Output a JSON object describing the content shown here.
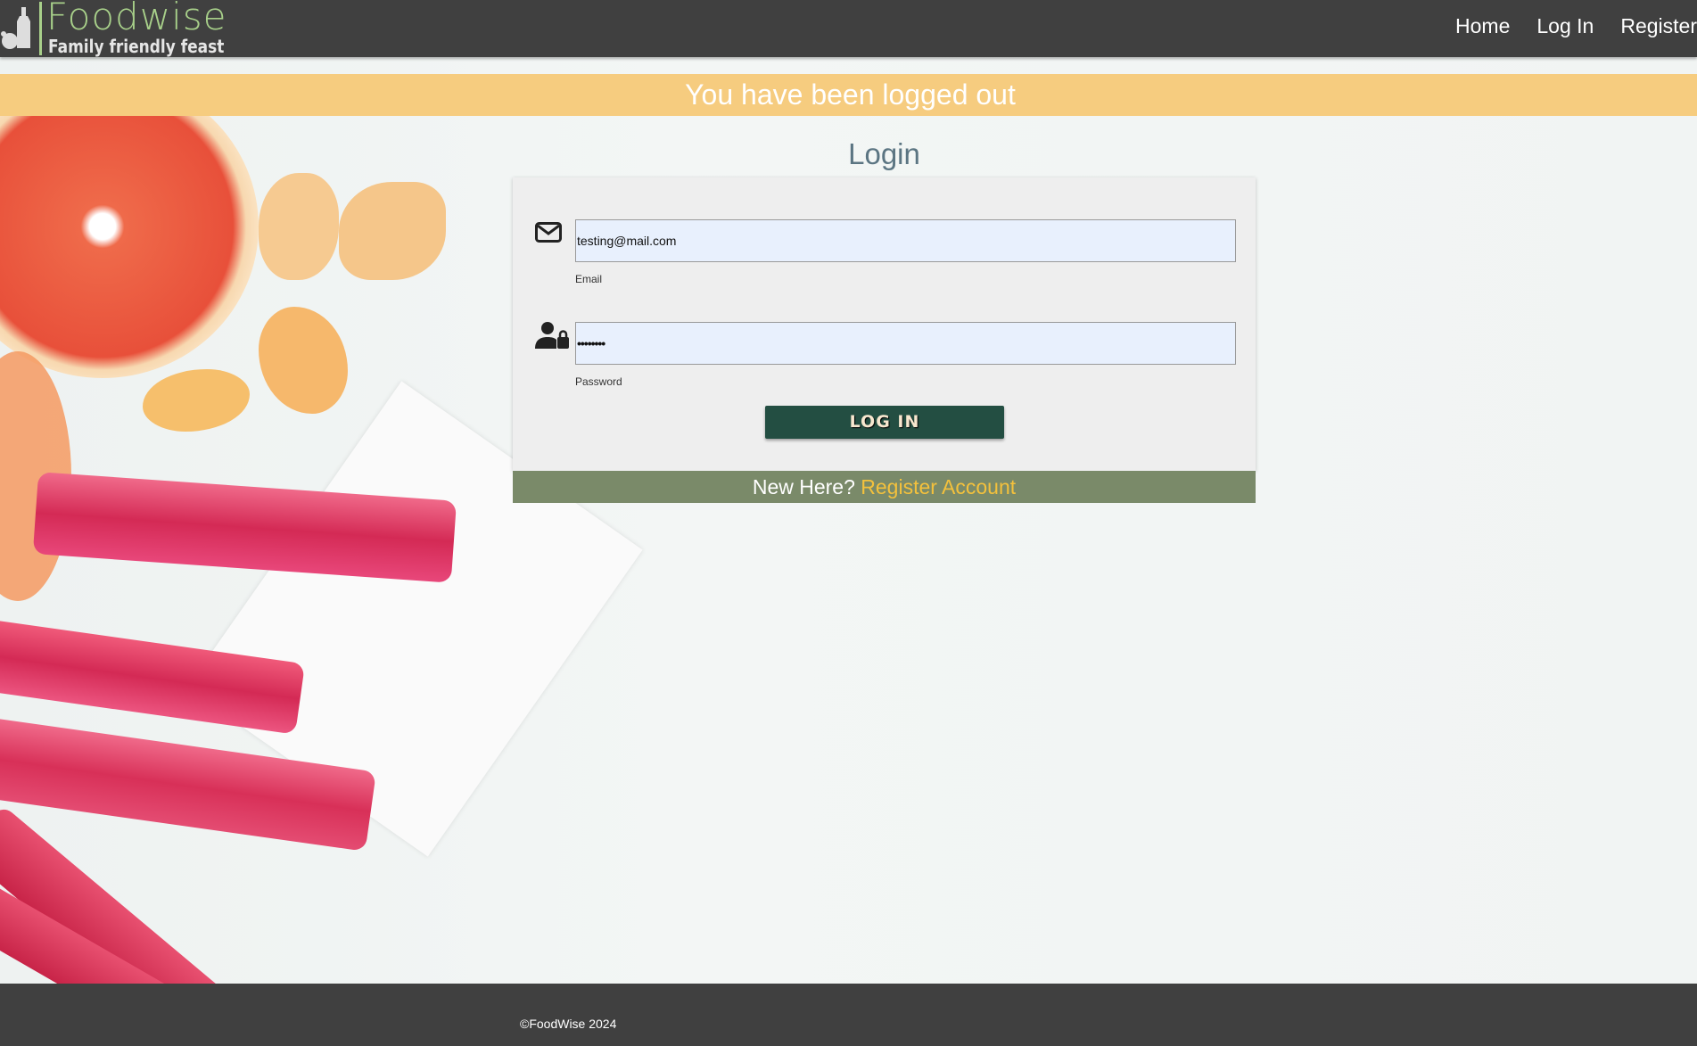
{
  "header": {
    "brand": "Foodwise",
    "tagline": "Family friendly feast",
    "nav": [
      "Home",
      "Log In",
      "Register"
    ]
  },
  "banner": {
    "message": "You have been logged out"
  },
  "login": {
    "title": "Login",
    "email": {
      "value": "testing@mail.com",
      "label": "Email",
      "icon": "envelope-icon"
    },
    "password": {
      "value": "••••••••",
      "label": "Password",
      "icon": "user-lock-icon"
    },
    "submit_label": "LOG IN",
    "new_here": "New Here?",
    "register_link": "Register Account"
  },
  "footer": {
    "copyright": "©FoodWise 2024"
  },
  "colors": {
    "header": "#404040",
    "brand": "#a8d08a",
    "banner": "#f6cc7f",
    "button": "#234e42",
    "register_bar": "#7a8a69",
    "link": "#f4c13c"
  }
}
